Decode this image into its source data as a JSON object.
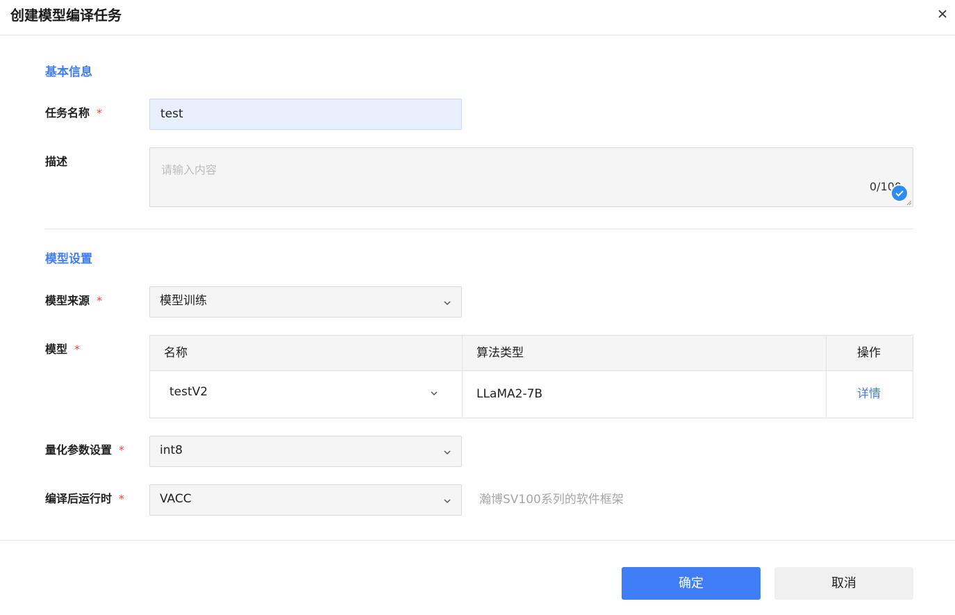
{
  "dialog": {
    "title": "创建模型编译任务",
    "close_icon": "close-icon"
  },
  "sections": {
    "basic": "基本信息",
    "model": "模型设置"
  },
  "task_name": {
    "label": "任务名称",
    "required": "*",
    "value": "test"
  },
  "description": {
    "label": "描述",
    "placeholder": "请输入内容",
    "count": "0/100"
  },
  "model_source": {
    "label": "模型来源",
    "required": "*",
    "value": "模型训练"
  },
  "model": {
    "label": "模型",
    "required": "*",
    "columns": [
      "名称",
      "算法类型",
      "操作"
    ],
    "row": {
      "name": "testV2",
      "algorithm": "LLaMA2-7B",
      "action": "详情"
    }
  },
  "quant": {
    "label": "量化参数设置",
    "required": "*",
    "value": "int8"
  },
  "runtime": {
    "label": "编译后运行时",
    "required": "*",
    "value": "VACC",
    "hint": "瀚博SV100系列的软件框架"
  },
  "footer": {
    "confirm": "确定",
    "cancel": "取消"
  },
  "colors": {
    "accent": "#3f7ef6",
    "required": "#e8453c"
  }
}
